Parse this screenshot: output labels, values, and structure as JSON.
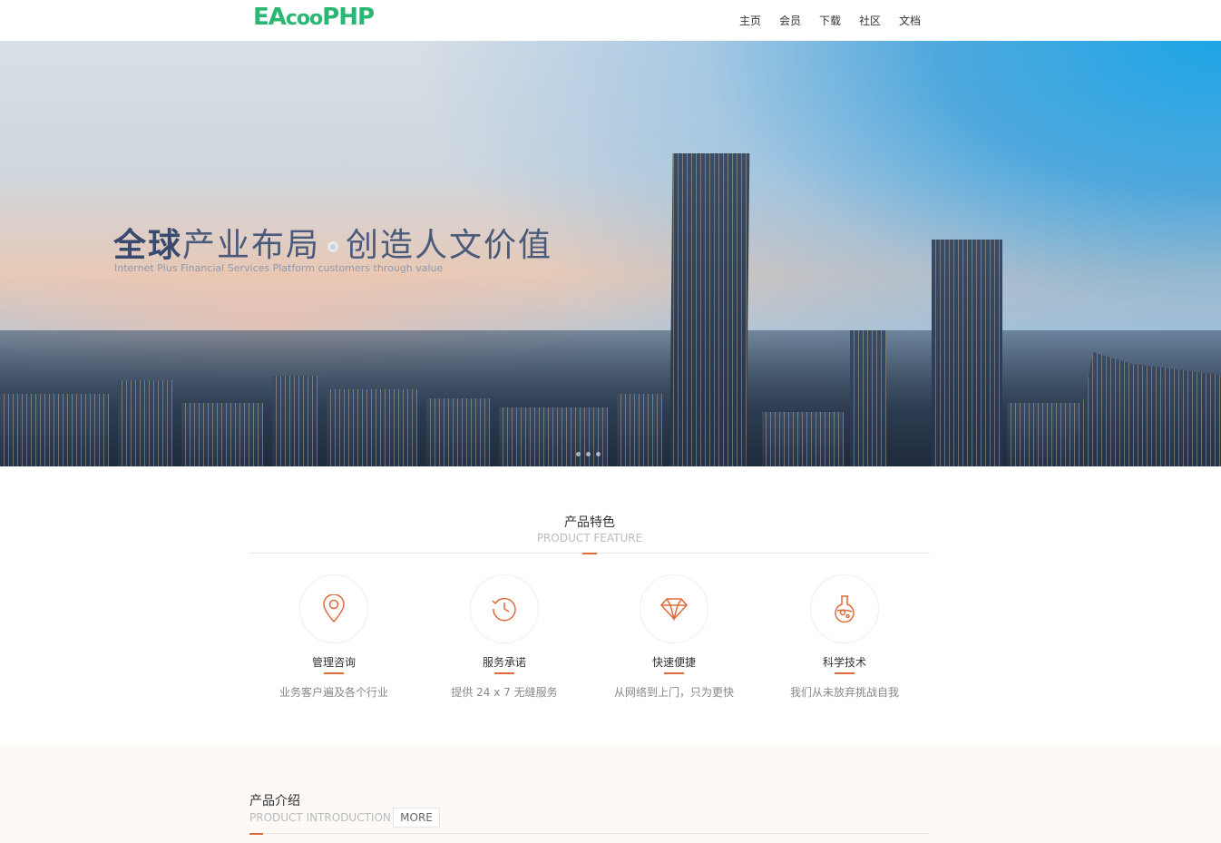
{
  "logo": {
    "part1": "EA",
    "part2": "coo",
    "part3": "PHP"
  },
  "nav": [
    "主页",
    "会员",
    "下载",
    "社区",
    "文档"
  ],
  "banner": {
    "title_bold": "全球",
    "title_rest1": "产业布局",
    "title_rest2": "创造人文价值",
    "subtitle": "Internet Plus Financial Services Platform customers through value"
  },
  "features_section": {
    "title": "产品特色",
    "subtitle": "PRODUCT FEATURE",
    "items": [
      {
        "name": "管理咨询",
        "desc": "业务客户遍及各个行业",
        "icon": "location-pin-icon"
      },
      {
        "name": "服务承诺",
        "desc": "提供 24 x 7 无缝服务",
        "icon": "clock-history-icon"
      },
      {
        "name": "快速便捷",
        "desc": "从网络到上门，只为更快",
        "icon": "diamond-icon"
      },
      {
        "name": "科学技术",
        "desc": "我们从未放弃挑战自我",
        "icon": "flask-icon"
      }
    ]
  },
  "intro_section": {
    "title": "产品介绍",
    "subtitle": "PRODUCT INTRODUCTION",
    "more_label": "MORE"
  },
  "colors": {
    "accent": "#e06a3c",
    "brand": "#2bb673"
  }
}
